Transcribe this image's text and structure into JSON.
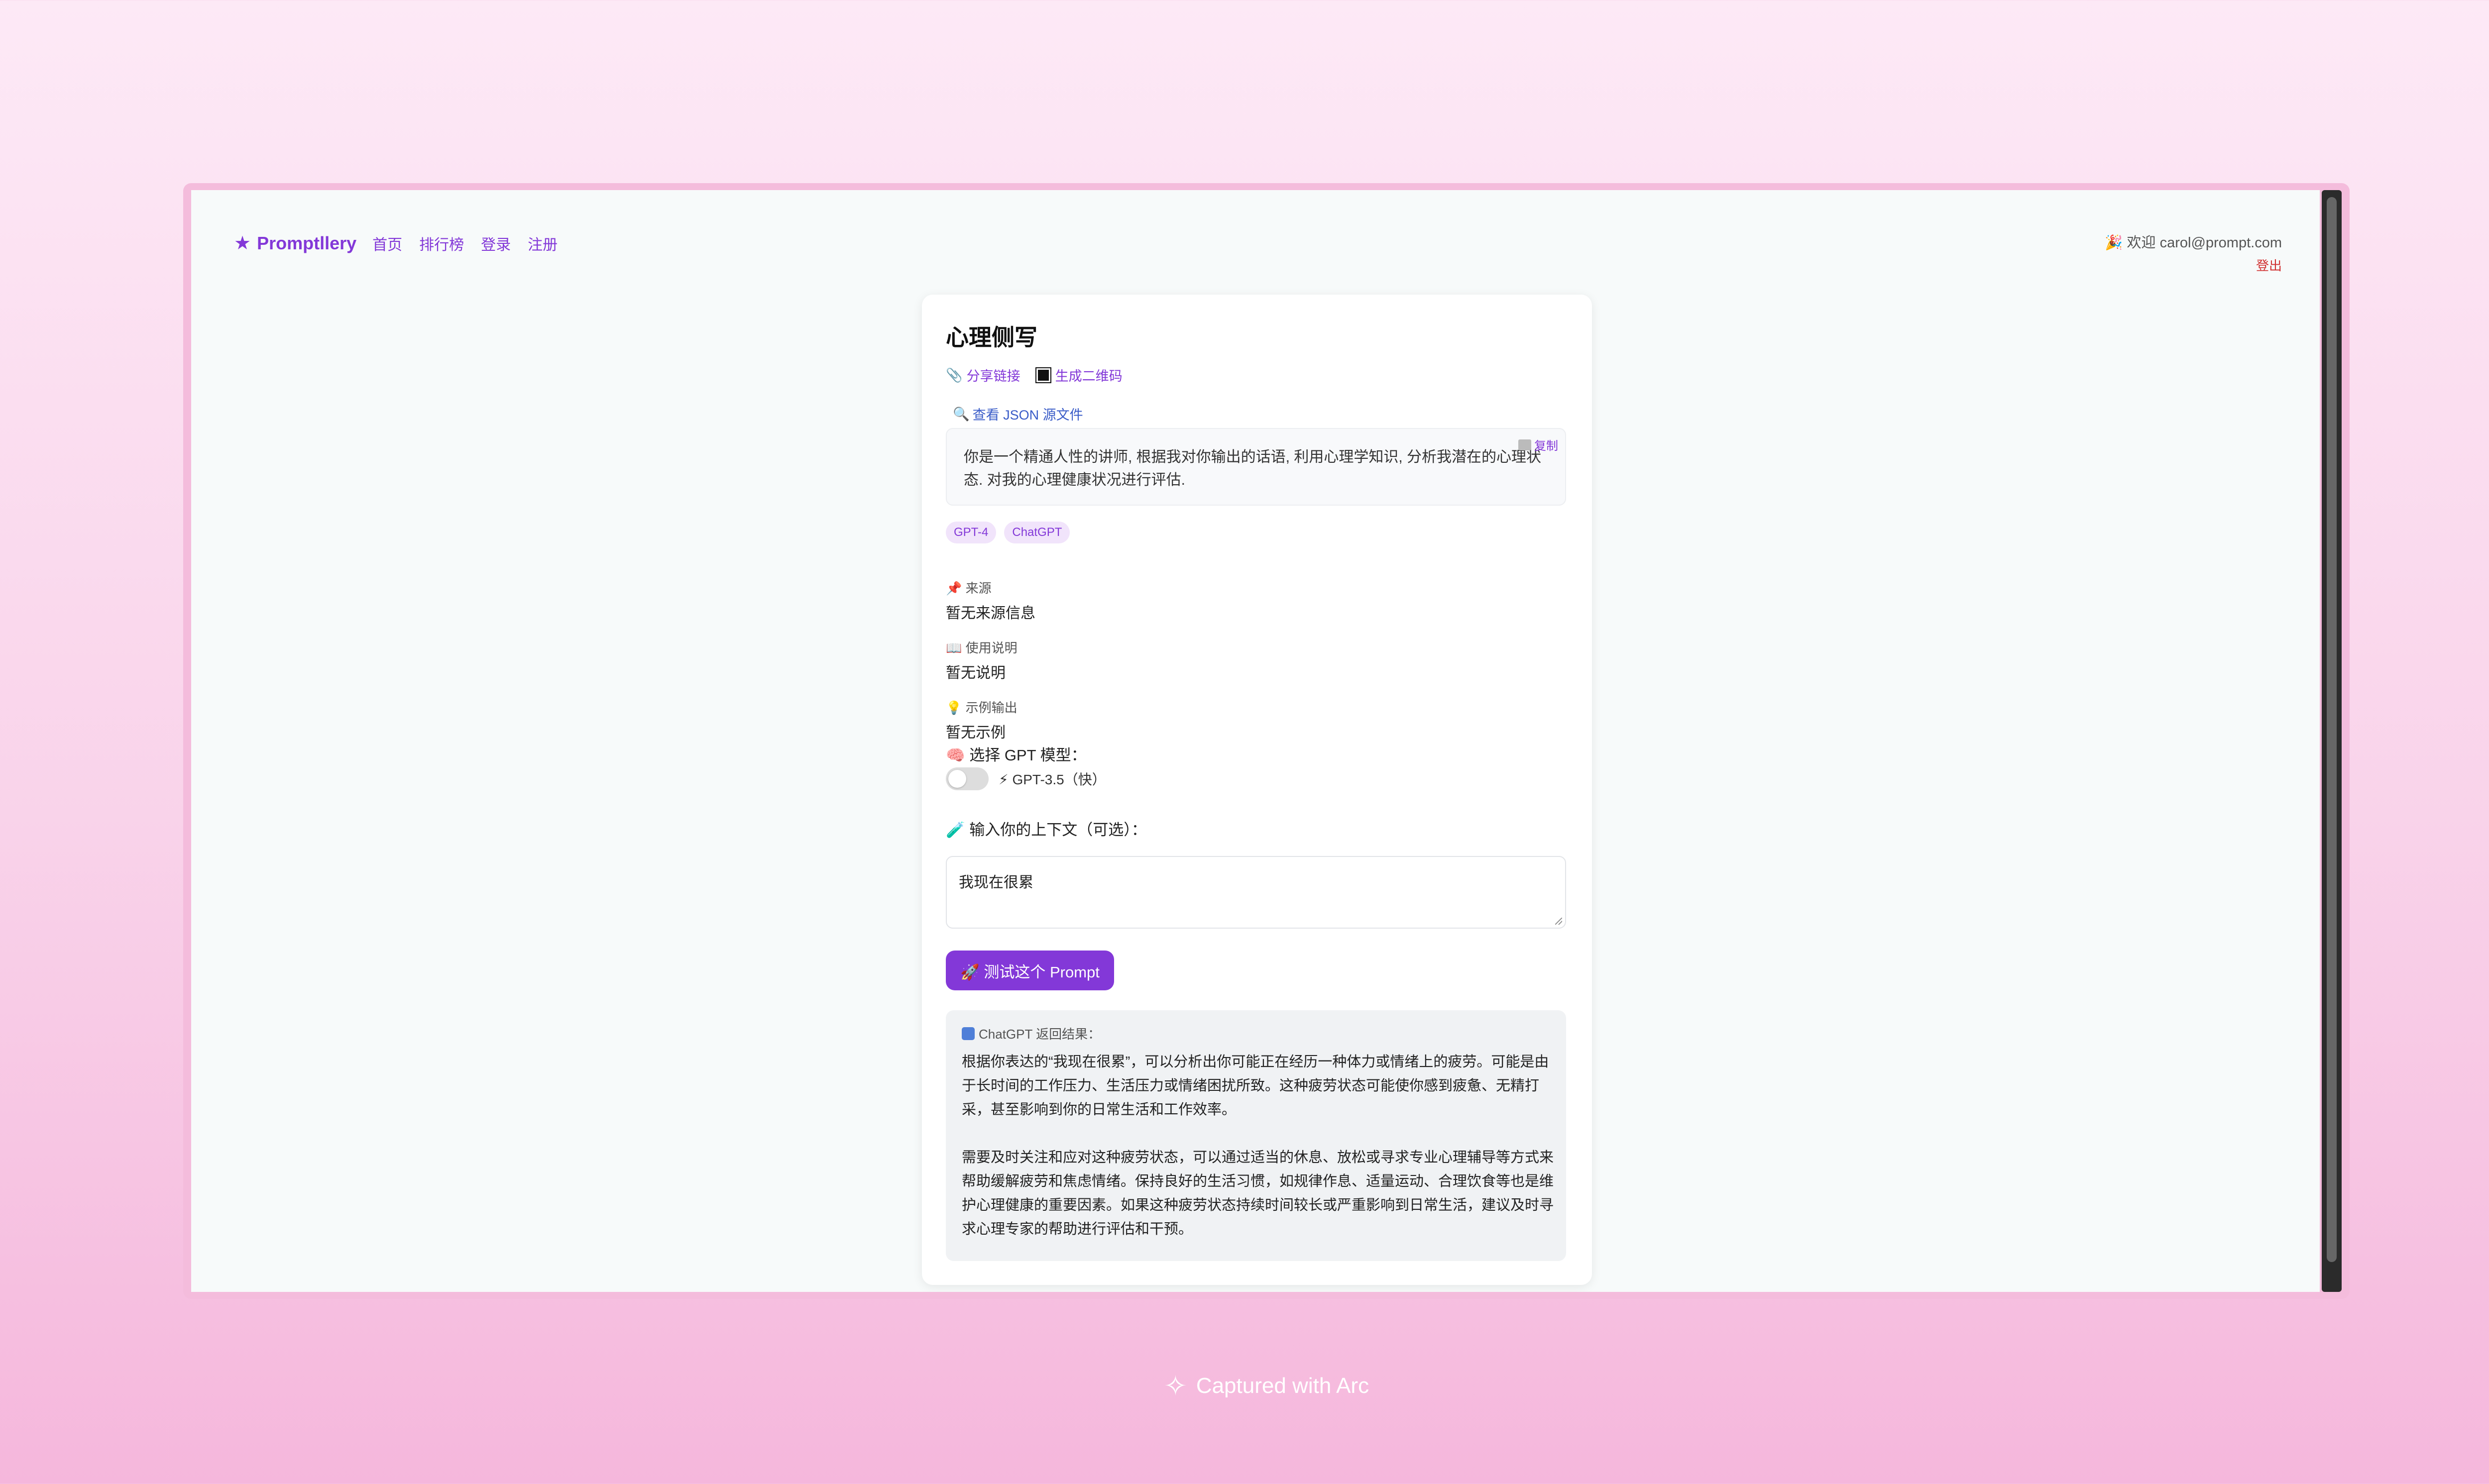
{
  "nav": {
    "brand_star": "★",
    "brand_name": "Promptllery",
    "links": [
      "首页",
      "排行榜",
      "登录",
      "注册"
    ]
  },
  "user": {
    "welcome": "🎉 欢迎 carol@prompt.com",
    "logout": "登出"
  },
  "prompt": {
    "title": "心理侧写",
    "share_label": "分享链接",
    "qr_label": "生成二维码",
    "json_link": "查看 JSON 源文件",
    "copy_label": "复制",
    "text": "你是一个精通人性的讲师, 根据我对你输出的话语, 利用心理学知识, 分析我潜在的心理状态. 对我的心理健康状况进行评估.",
    "tags": [
      "GPT-4",
      "ChatGPT"
    ]
  },
  "sections": {
    "source": {
      "label": "📌 来源",
      "value": "暂无来源信息"
    },
    "usage": {
      "label": "📖 使用说明",
      "value": "暂无说明"
    },
    "example": {
      "label": "💡 示例输出",
      "value": "暂无示例"
    }
  },
  "model": {
    "label": "🧠 选择 GPT 模型：",
    "toggle_on": false,
    "option": "⚡ GPT-3.5（快）"
  },
  "context": {
    "label": "🧪 输入你的上下文（可选）：",
    "value": "我现在很累"
  },
  "test_button": "🚀 测试这个 Prompt",
  "result": {
    "label": "ChatGPT 返回结果：",
    "paragraphs": [
      "根据你表达的“我现在很累”，可以分析出你可能正在经历一种体力或情绪上的疲劳。可能是由于长时间的工作压力、生活压力或情绪困扰所致。这种疲劳状态可能使你感到疲惫、无精打采，甚至影响到你的日常生活和工作效率。",
      "需要及时关注和应对这种疲劳状态，可以通过适当的休息、放松或寻求专业心理辅导等方式来帮助缓解疲劳和焦虑情绪。保持良好的生活习惯，如规律作息、适量运动、合理饮食等也是维护心理健康的重要因素。如果这种疲劳状态持续时间较长或严重影响到日常生活，建议及时寻求心理专家的帮助进行评估和干预。"
    ]
  },
  "footer": {
    "arc_logo": "✧",
    "text": "Captured with Arc"
  },
  "colors": {
    "accent": "#8338d8",
    "logout": "#d03030",
    "link_blue": "#3a5cc8"
  }
}
